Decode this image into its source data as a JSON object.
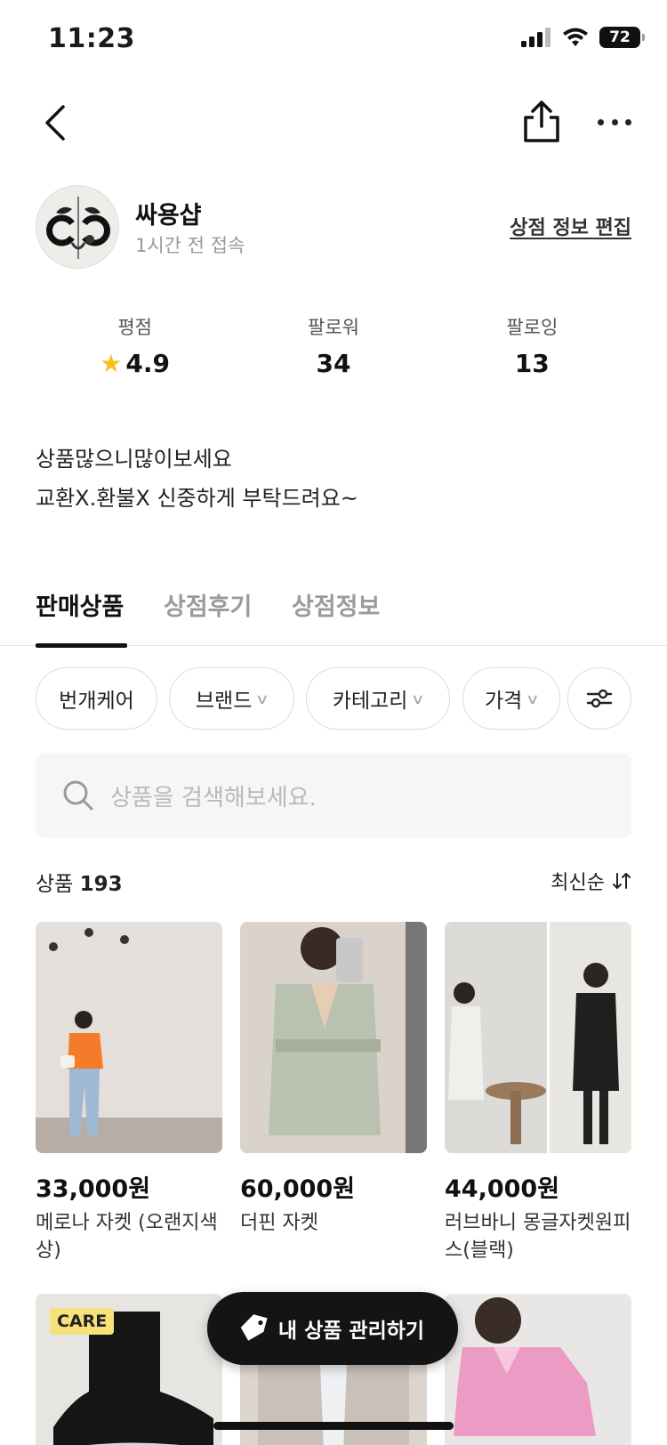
{
  "status_bar": {
    "time": "11:23",
    "battery": "72"
  },
  "profile": {
    "shop_name": "싸용샵",
    "last_login": "1시간 전 접속",
    "edit_label": "상점 정보 편집"
  },
  "stats": {
    "rating_label": "평점",
    "rating_value": "4.9",
    "followers_label": "팔로워",
    "followers_value": "34",
    "following_label": "팔로잉",
    "following_value": "13"
  },
  "intro": {
    "line1": "상품많으니많이보세요",
    "line2": "교환X.환불X 신중하게 부탁드려요~"
  },
  "tabs": [
    {
      "label": "판매상품",
      "active": true
    },
    {
      "label": "상점후기",
      "active": false
    },
    {
      "label": "상점정보",
      "active": false
    }
  ],
  "filters": {
    "care": "번개케어",
    "brand": "브랜드",
    "category": "카테고리",
    "price": "가격"
  },
  "search": {
    "placeholder": "상품을 검색해보세요."
  },
  "list": {
    "count_prefix": "상품",
    "count": "193",
    "sort_label": "최신순"
  },
  "products": [
    {
      "price": "33,000원",
      "name": "메로나 자켓 (오랜지색상)"
    },
    {
      "price": "60,000원",
      "name": "더핀 자켓"
    },
    {
      "price": "44,000원",
      "name": "러브바니 몽글자켓원피스(블랙)"
    }
  ],
  "badges": {
    "care": "CARE"
  },
  "fab": {
    "label": "내 상품 관리하기"
  },
  "colors": {
    "star": "#f5c11b",
    "fab_bg": "#141414",
    "care_badge": "#f7e27a"
  }
}
